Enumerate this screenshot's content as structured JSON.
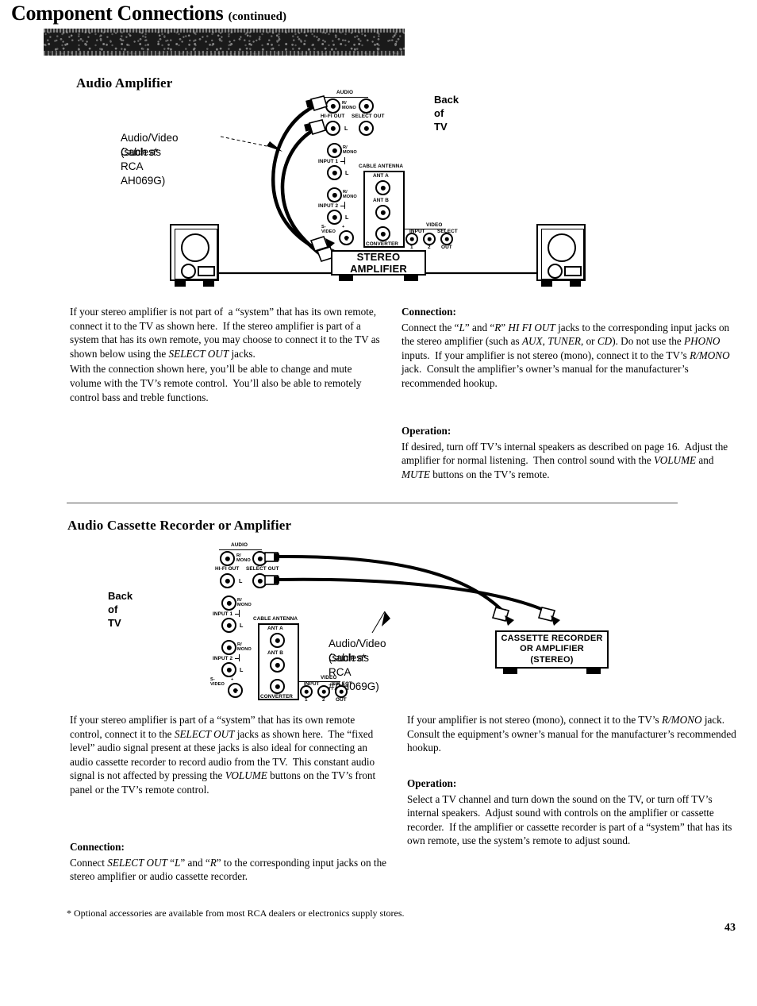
{
  "header": {
    "title": "Component Connections",
    "continued": "(continued)"
  },
  "section1": {
    "heading": "Audio Amplifier",
    "diagram": {
      "back_of_tv_label": "Back of TV",
      "cable_callout_line1": "Audio/Video Cables*",
      "cable_callout_line2": "(such as RCA AH069G)",
      "device_label": "STEREO AMPLIFIER",
      "panel": {
        "audio": "AUDIO",
        "r_mono": "R/\nMONO",
        "hifi_out": "HI-FI OUT",
        "select_out": "SELECT OUT",
        "left": "L",
        "input1": "INPUT 1",
        "input2": "INPUT 2",
        "s_video": "S-\nVIDEO",
        "cable_antenna": "CABLE ANTENNA",
        "ant_a": "ANT A",
        "ant_b": "ANT B",
        "converter": "CONVERTER",
        "video": "VIDEO",
        "video_input": "INPUT",
        "video_select": "SELECT",
        "video_1": "1",
        "video_2": "2",
        "video_out": "OUT"
      }
    },
    "left_column": [
      "If your stereo amplifier is not part of  a “system” that has its own remote, connect it to the TV as shown here.  If the stereo amplifier is part of a system that has its own remote, you may choose to connect it to the TV as shown below using the SELECT OUT jacks.",
      "With the connection shown here, you’ll be able to change and mute volume with the TV’s remote control.  You’ll also be able to remotely control bass and treble functions."
    ],
    "connection_label": "Connection:",
    "connection_text": "Connect the “L” and “R” HI FI OUT jacks to the corresponding input jacks on the stereo amplifier (such as AUX, TUNER, or CD).  Do not use the PHONO inputs.  If your amplifier is not stereo (mono), connect it to the TV’s R/MONO jack.  Consult the amplifier’s owner’s manual for the manufacturer’s recommended hookup.",
    "operation_label": "Operation:",
    "operation_text": "If desired, turn off TV’s internal speakers as described on page 16.  Adjust the amplifier for normal listening.  Then control sound with the VOLUME and MUTE buttons on the TV’s remote."
  },
  "section2": {
    "heading": "Audio Cassette Recorder or Amplifier",
    "diagram": {
      "back_of_tv_label": "Back of TV",
      "cable_callout_line1": "Audio/Video Cables*",
      "cable_callout_line2": "(such as RCA #AH069G)",
      "device_label_line1": "CASSETTE RECORDER",
      "device_label_line2": "OR AMPLIFIER",
      "device_label_line3": "(STEREO)"
    },
    "left_column": [
      "If your stereo amplifier is part of a “system” that has its own remote control, connect it to the SELECT OUT jacks as shown here.  The “fixed level” audio signal present at these jacks is also ideal for connecting an audio cassette recorder to record audio from the TV.  This constant audio signal is not affected by pressing the VOLUME buttons on the TV’s front panel or the TV’s remote control."
    ],
    "connection_label": "Connection:",
    "connection_text": "Connect SELECT OUT “L” and “R” to the corresponding input jacks on the stereo amplifier or audio cassette recorder.",
    "right_intro": "If your amplifier is not stereo (mono), connect it to the TV’s R/MONO jack.  Consult the equipment’s owner’s manual for the manufacturer’s recommended hookup.",
    "operation_label": "Operation:",
    "operation_text": "Select a TV channel and turn down the sound on the TV, or turn off TV’s internal speakers.  Adjust sound with controls on the amplifier or cassette recorder.  If the amplifier or cassette recorder is part of a “system” that has its own remote, use the system’s remote to adjust sound."
  },
  "footer": {
    "footnote": "* Optional accessories are available from most RCA dealers or electronics supply stores.",
    "page_number": "43"
  }
}
